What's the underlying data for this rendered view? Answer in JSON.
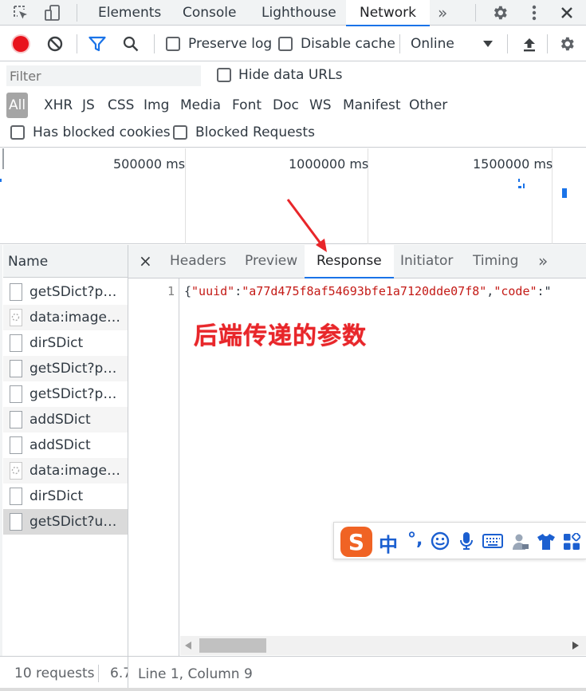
{
  "toolbar": {
    "tabs": [
      "Elements",
      "Console",
      "Lighthouse",
      "Network"
    ],
    "active_tab": "Network",
    "more_tabs": "»"
  },
  "network_bar": {
    "preserve_log": "Preserve log",
    "disable_cache": "Disable cache",
    "throttle": "Online"
  },
  "filter": {
    "placeholder": "Filter",
    "hide_data_urls": "Hide data URLs",
    "types": [
      "All",
      "XHR",
      "JS",
      "CSS",
      "Img",
      "Media",
      "Font",
      "Doc",
      "WS",
      "Manifest",
      "Other"
    ],
    "has_blocked_cookies": "Has blocked cookies",
    "blocked_requests": "Blocked Requests"
  },
  "overview": {
    "ticks": [
      "500000 ms",
      "1000000 ms",
      "1500000 ms"
    ]
  },
  "requests": {
    "header": "Name",
    "items": [
      {
        "name": "getSDict?par...",
        "kind": "doc"
      },
      {
        "name": "data:image/...",
        "kind": "img"
      },
      {
        "name": "dirSDict",
        "kind": "doc"
      },
      {
        "name": "getSDict?par...",
        "kind": "doc"
      },
      {
        "name": "getSDict?par...",
        "kind": "doc"
      },
      {
        "name": "addSDict",
        "kind": "doc"
      },
      {
        "name": "addSDict",
        "kind": "doc"
      },
      {
        "name": "data:image/...",
        "kind": "img"
      },
      {
        "name": "dirSDict",
        "kind": "doc"
      },
      {
        "name": "getSDict?uui...",
        "kind": "doc"
      }
    ],
    "summary": "10 requests",
    "summary_cut": "6.7"
  },
  "detail": {
    "close": "×",
    "tabs": [
      "Headers",
      "Preview",
      "Response",
      "Initiator",
      "Timing"
    ],
    "active_tab": "Response",
    "more": "»",
    "line_number": "1",
    "code_p1": "{",
    "code_k1": "\"uuid\"",
    "code_p2": ":",
    "code_v1": "\"a77d475f8af54693bfe1a7120dde07f8\"",
    "code_p3": ",",
    "code_k2": "\"code\"",
    "code_p4": ":\"",
    "status": "Line 1, Column 9"
  },
  "annotation": {
    "text": "后端传递的参数",
    "color": "#e8262a"
  },
  "ime": {
    "logo": "S",
    "mode": "中",
    "punct": "°,"
  },
  "colors": {
    "accent": "#1a73e8",
    "record": "#e8131c",
    "json_key": "#c41a16"
  }
}
